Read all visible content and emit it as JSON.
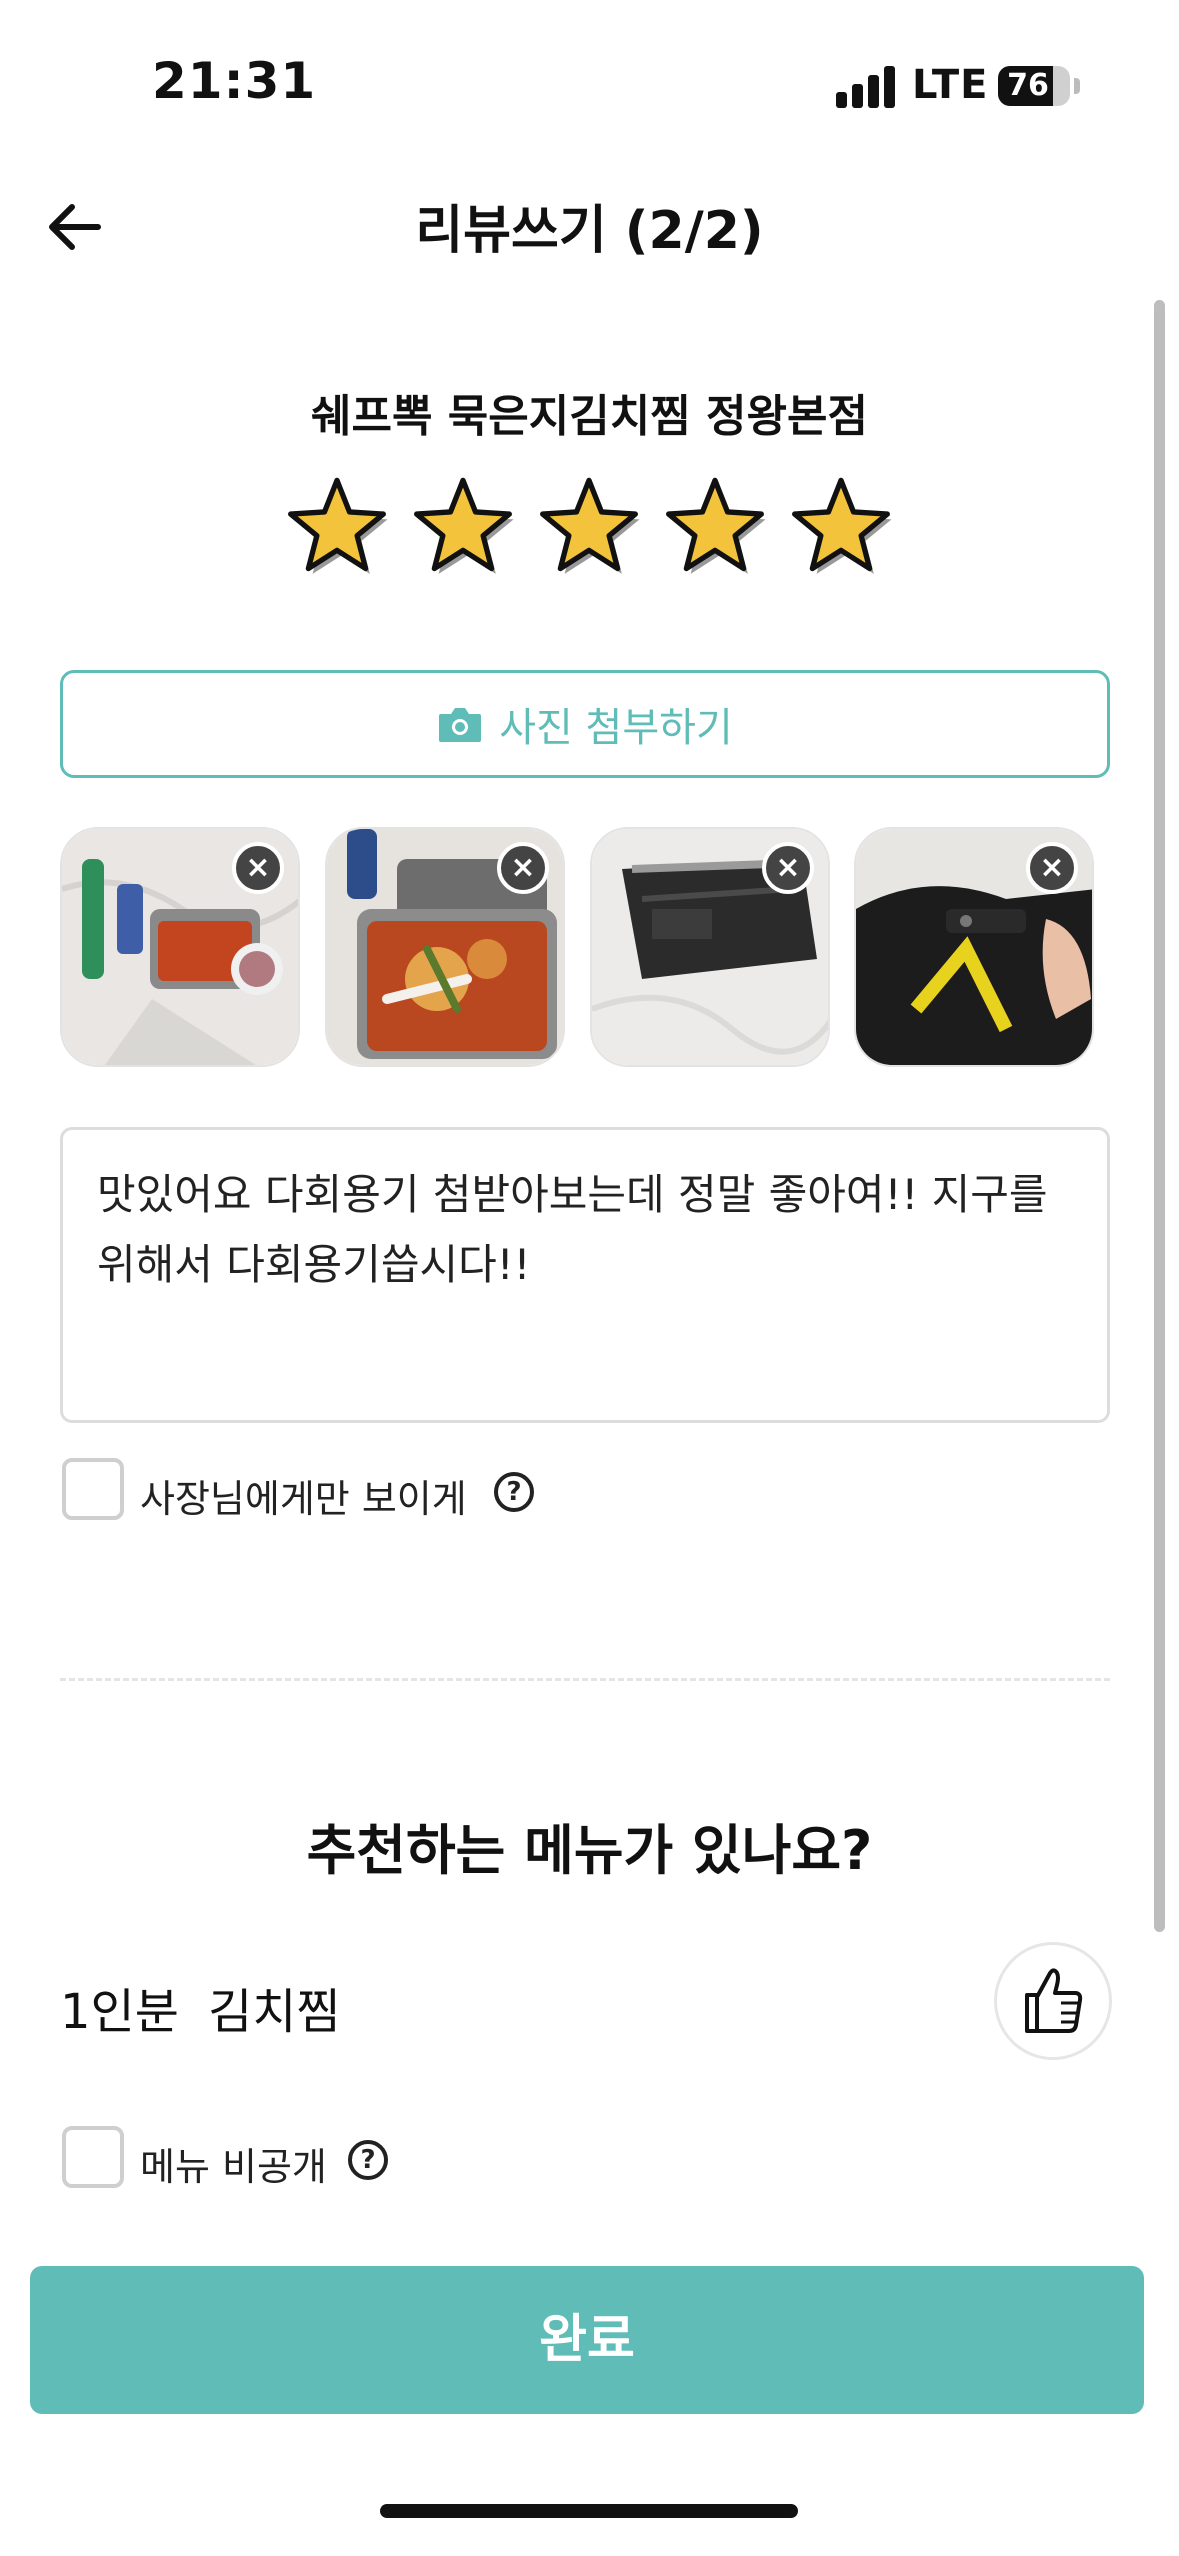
{
  "status_bar": {
    "time": "21:31",
    "network": "LTE",
    "battery_level": 76,
    "battery_text": "76"
  },
  "header": {
    "back_icon": "arrow-left-icon",
    "title": "리뷰쓰기 (2/2)"
  },
  "store": {
    "name": "쉐프뽁 묵은지김치찜 정왕본점"
  },
  "rating": {
    "value": 5,
    "max": 5,
    "star_color": "#f3c33c"
  },
  "attach": {
    "icon": "camera-icon",
    "label": "사진 첨부하기"
  },
  "photos": [
    {
      "remove_glyph": "×"
    },
    {
      "remove_glyph": "×"
    },
    {
      "remove_glyph": "×"
    },
    {
      "remove_glyph": "×"
    }
  ],
  "review": {
    "text": "맛있어요 다회용기 첨받아보는데 정말 좋아여!! 지구를 위해서 다회용기씁시다!!"
  },
  "owner_only": {
    "label": "사장님에게만 보이게",
    "checked": false,
    "help_glyph": "?"
  },
  "recommend": {
    "title": "추천하는 메뉴가 있나요?",
    "menu_name": "1인분 김치찜",
    "like_icon": "thumbs-up-icon"
  },
  "menu_private": {
    "label": "메뉴 비공개",
    "checked": false,
    "help_glyph": "?"
  },
  "done_button": {
    "label": "완료"
  },
  "colors": {
    "accent": "#5fbcb7",
    "border": "#dddddd"
  }
}
